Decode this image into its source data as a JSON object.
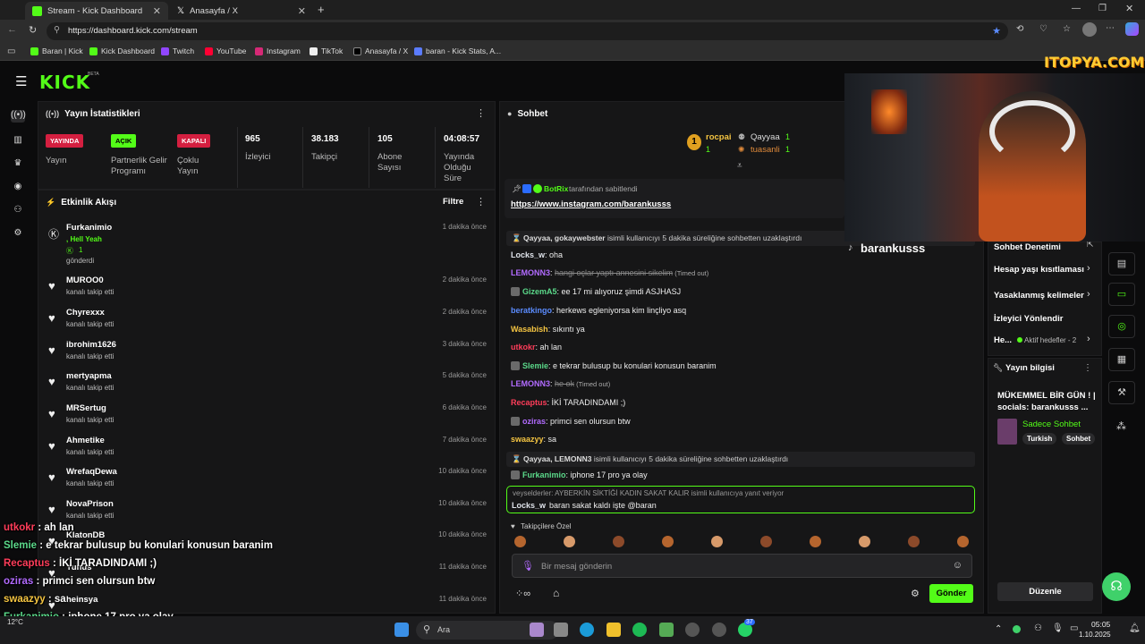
{
  "browser": {
    "tabs": [
      {
        "title": "Stream - Kick Dashboard",
        "active": true
      },
      {
        "title": "Anasayfa / X",
        "active": false
      }
    ],
    "new_tab_glyph": "+",
    "url": "https://dashboard.kick.com/stream",
    "bookmarks": [
      "Baran | Kick",
      "Kick Dashboard",
      "Twitch",
      "YouTube",
      "Instagram",
      "TikTok",
      "Anasayfa / X",
      "baran - Kick Stats, A..."
    ]
  },
  "brand": {
    "logo": "KICK",
    "beta": "BETA",
    "accent": "#53fc18"
  },
  "stats": {
    "title": "Yayın İstatistikleri",
    "live_badge": "YAYINDA",
    "live_label": "Yayın",
    "partner_badge": "AÇIK",
    "partner_label": "Partnerlik Gelir Programı",
    "multi_badge": "KAPALI",
    "multi_label": "Çoklu Yayın",
    "viewers": "965",
    "viewers_label": "İzleyici",
    "followers": "38.183",
    "followers_label": "Takipçi",
    "subs": "105",
    "subs_label": "Abone Sayısı",
    "uptime": "04:08:57",
    "uptime_label": "Yayında Olduğu Süre"
  },
  "activity": {
    "title": "Etkinlik Akışı",
    "filter": "Filtre",
    "items": [
      {
        "name": "Furkanimio",
        "sub": "gönderdi",
        "extra": ", Hell Yeah",
        "amount": "1",
        "time": "1 dakika önce"
      },
      {
        "name": "MUROO0",
        "sub": "kanalı takip etti",
        "time": "2 dakika önce"
      },
      {
        "name": "Chyrexxx",
        "sub": "kanalı takip etti",
        "time": "2 dakika önce"
      },
      {
        "name": "ibrohim1626",
        "sub": "kanalı takip etti",
        "time": "3 dakika önce"
      },
      {
        "name": "mertyapma",
        "sub": "kanalı takip etti",
        "time": "5 dakika önce"
      },
      {
        "name": "MRSertug",
        "sub": "kanalı takip etti",
        "time": "6 dakika önce"
      },
      {
        "name": "Ahmetike",
        "sub": "kanalı takip etti",
        "time": "7 dakika önce"
      },
      {
        "name": "WrefaqDewa",
        "sub": "kanalı takip etti",
        "time": "10 dakika önce"
      },
      {
        "name": "NovaPrison",
        "sub": "kanalı takip etti",
        "time": "10 dakika önce"
      },
      {
        "name": "KlatonDB",
        "sub": "",
        "time": "10 dakika önce"
      },
      {
        "name": "Yunus",
        "sub": "",
        "time": "11 dakika önce"
      },
      {
        "name": "heinsya",
        "sub": "",
        "time": "11 dakika önce"
      }
    ]
  },
  "chat": {
    "title": "Sohbet",
    "leaders": [
      {
        "name": "rocpai",
        "count": "1"
      },
      {
        "name": "Qayyaa",
        "count": "1"
      },
      {
        "name": "tuasanli",
        "count": "1"
      }
    ],
    "pinned_by": "BotRix",
    "pinned_text": "tarafından sabitlendi",
    "pinned_link": "https://www.instagram.com/barankusss",
    "messages": [
      {
        "type": "sys",
        "users": "Qayyaa, gokaywebster",
        "text": "isimli kullanıcıyı 5 dakika süreliğine sohbetten uzaklaştırdı"
      },
      {
        "user": "Locks_w",
        "color": "#dfe3ea",
        "text": "oha"
      },
      {
        "user": "LEMONN3",
        "color": "#b26bff",
        "text": "hangi oçlar yaptı annesini sikelim",
        "note": "(Timed out)",
        "struck": true
      },
      {
        "user": "GizemA5",
        "color": "#5bd98a",
        "text": "ee 17 mi alıyoruz şimdi ASJHASJ"
      },
      {
        "user": "beratkingo",
        "color": "#5b8cff",
        "text": "herkews egleniyorsa kim linçliyo asq"
      },
      {
        "user": "Wasabish",
        "color": "#f5c542",
        "text": "sıkıntı ya"
      },
      {
        "user": "utkokr",
        "color": "#ff3d5a",
        "text": "ah lan"
      },
      {
        "user": "Slemie",
        "color": "#5bd98a",
        "text": "e tekrar bulusup bu konulari konusun baranim"
      },
      {
        "user": "LEMONN3",
        "color": "#b26bff",
        "text": "he ok",
        "note": "(Timed out)",
        "struck": true
      },
      {
        "user": "Recaptus",
        "color": "#ff3d5a",
        "text": "İKİ TARADINDAMI ;)"
      },
      {
        "user": "oziras",
        "color": "#b26bff",
        "text": "primci sen olursun btw"
      },
      {
        "user": "swaazyy",
        "color": "#f5c542",
        "text": "sa"
      },
      {
        "type": "sys",
        "users": "Qayyaa, LEMONN3",
        "text": "isimli kullanıcıyı 5 dakika süreliğine sohbetten uzaklaştırdı"
      },
      {
        "user": "Furkanimio",
        "color": "#5bd98a",
        "text": "iphone 17 pro ya olay"
      }
    ],
    "reply_context": "veyselderler: AYBERKİN SİKTİĞİ KADIN SAKAT KALIR isimli kullanıcıya yanıt veriyor",
    "reply_user": "Locks_w",
    "reply_text": "baran sakat kaldı işte @baran",
    "followers_only": "Takipçilere Özel",
    "placeholder": "Bir mesaj gönderin",
    "send": "Gönder"
  },
  "streamer": {
    "name": "barankusss",
    "overlay_brand": "ITOPYA.COM"
  },
  "side": {
    "moderation": "Sohbet Denetimi",
    "items": [
      "Hesap yaşı kısıtlaması",
      "Yasaklanmış kelimeler",
      "İzleyici Yönlendir",
      "He...",
      "Aktif hedefler - 2"
    ],
    "info_title": "Yayın bilgisi",
    "stream_title": "MÜKEMMEL BİR GÜN ! | socials: barankusss ...",
    "category": "Sadece Sohbet",
    "tags": [
      "Turkish",
      "Sohbet"
    ],
    "edit": "Düzenle"
  },
  "overlay_chat": [
    {
      "user": "utkokr",
      "color": "#ff3d5a",
      "text": ": ah lan"
    },
    {
      "user": "Slemie",
      "color": "#5bd98a",
      "text": ": e tekrar bulusup bu konulari konusun baranim"
    },
    {
      "user": "Recaptus",
      "color": "#ff3d5a",
      "text": ": İKİ TARADINDAMI ;)"
    },
    {
      "user": "oziras",
      "color": "#b26bff",
      "text": ": primci sen olursun btw"
    },
    {
      "user": "swaazyy",
      "color": "#f5c542",
      "text": ": sa"
    },
    {
      "user": "Furkanimio",
      "color": "#5bd98a",
      "text": ": iphone 17 pro ya olay"
    },
    {
      "user": "Locks_w",
      "color": "#ffffff",
      "text": ": baran sakat kaldı işte @baran"
    }
  ],
  "taskbar": {
    "search": "Ara",
    "weather": "12°C",
    "time": "05:05",
    "date": "1.10.2025",
    "badge": "37"
  }
}
